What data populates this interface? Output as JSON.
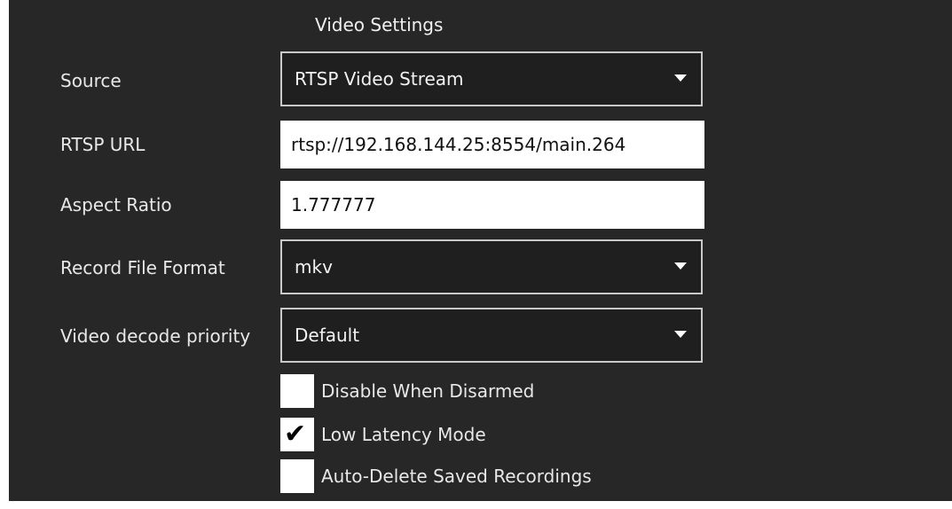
{
  "section": {
    "title": "Video Settings"
  },
  "rows": {
    "source": {
      "label": "Source",
      "value": "RTSP Video Stream"
    },
    "rtsp_url": {
      "label": "RTSP URL",
      "value": "rtsp://192.168.144.25:8554/main.264"
    },
    "aspect_ratio": {
      "label": "Aspect Ratio",
      "value": "1.777777"
    },
    "record_format": {
      "label": "Record File Format",
      "value": "mkv"
    },
    "decode_priority": {
      "label": "Video decode priority",
      "value": "Default"
    }
  },
  "checkboxes": {
    "disable_when_disarmed": {
      "label": "Disable When Disarmed",
      "checked": false
    },
    "low_latency": {
      "label": "Low Latency Mode",
      "checked": true,
      "mark": "✔"
    },
    "auto_delete": {
      "label": "Auto-Delete Saved Recordings",
      "checked": false
    }
  },
  "icons": {
    "dropdown": "caret-down-icon",
    "check": "checkmark-icon"
  },
  "colors": {
    "panel_bg": "#272727",
    "combo_bg": "#1f1f1f",
    "combo_border": "#c9c9c9",
    "input_bg": "#ffffff",
    "text": "#ffffff"
  }
}
